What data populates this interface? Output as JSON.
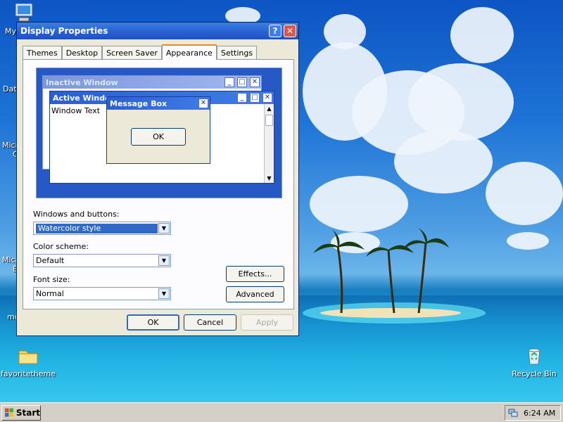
{
  "desktop": {
    "icons": [
      {
        "label": "favoritetheme",
        "icon": "folder-icon"
      },
      {
        "label": "Recycle Bin",
        "icon": "recycle-bin-icon"
      }
    ],
    "edge_labels": [
      "My",
      "Dat",
      "Micr",
      "C",
      "Micr",
      "E",
      "mc"
    ]
  },
  "dialog": {
    "title": "Display Properties",
    "help_button": "?",
    "close_button": "✕",
    "tabs": [
      {
        "label": "Themes",
        "active": false
      },
      {
        "label": "Desktop",
        "active": false
      },
      {
        "label": "Screen Saver",
        "active": false
      },
      {
        "label": "Appearance",
        "active": true
      },
      {
        "label": "Settings",
        "active": false
      }
    ],
    "preview": {
      "inactive_title": "Inactive Window",
      "active_title": "Active Window",
      "window_text": "Window Text",
      "message_title": "Message Box",
      "ok_label": "OK"
    },
    "form": {
      "windows_buttons_label": "Windows and buttons:",
      "windows_buttons_value": "Watercolor style",
      "color_scheme_label": "Color scheme:",
      "color_scheme_value": "Default",
      "font_size_label": "Font size:",
      "font_size_value": "Normal",
      "effects_button": "Effects...",
      "advanced_button": "Advanced"
    },
    "footer": {
      "ok": "OK",
      "cancel": "Cancel",
      "apply": "Apply"
    }
  },
  "taskbar": {
    "start_label": "Start",
    "clock": "6:24 AM"
  },
  "colors": {
    "titlebar": "#2a61d3",
    "preview_bg": "#2659c5",
    "active_tab_accent": "#e68b2c"
  }
}
